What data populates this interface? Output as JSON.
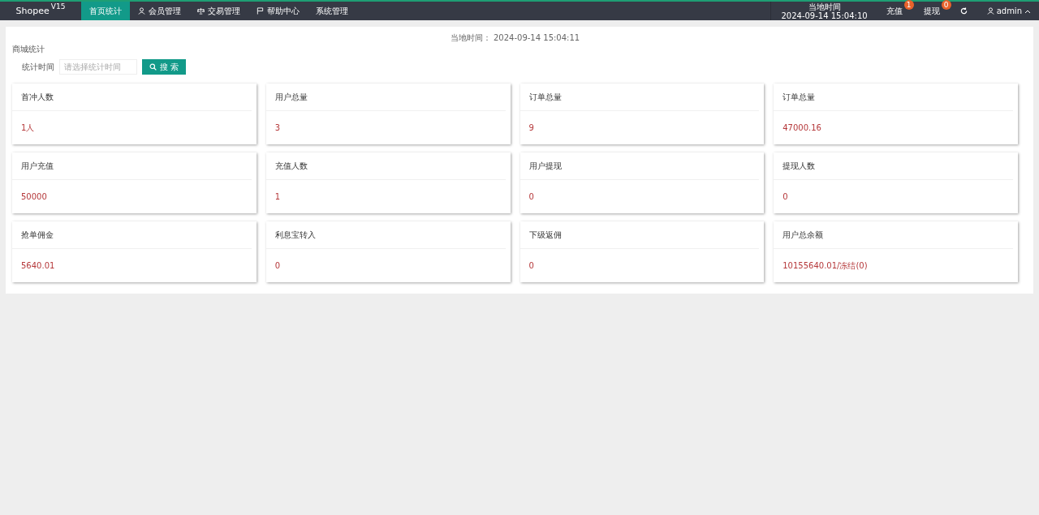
{
  "topbar": {
    "logo": "Shopee",
    "version": "V15",
    "nav": [
      {
        "label": "首页统计",
        "kind": "plain",
        "selected": true
      },
      {
        "label": "会员管理",
        "kind": "user",
        "selected": false
      },
      {
        "label": "交易管理",
        "kind": "scale",
        "selected": false
      },
      {
        "label": "帮助中心",
        "kind": "flag",
        "selected": false
      },
      {
        "label": "系统管理",
        "kind": "plain",
        "selected": false
      }
    ],
    "clock_label": "当地时间",
    "clock_value": "2024-09-14 15:04:10",
    "alerts": [
      {
        "label": "充值",
        "count": "1"
      },
      {
        "label": "提现",
        "count": "0"
      }
    ],
    "user": "admin"
  },
  "panel": {
    "title": "商城统计",
    "local_time": "当地时间： 2024-09-14 15:04:11",
    "filter": {
      "label": "统计时间",
      "placeholder": "请选择统计时间",
      "button": "搜 索"
    },
    "cards": [
      {
        "title": "首冲人数",
        "value": "1人"
      },
      {
        "title": "用户总量",
        "value": "3"
      },
      {
        "title": "订单总量",
        "value": "9"
      },
      {
        "title": "订单总量",
        "value": "47000.16"
      },
      {
        "title": "用户充值",
        "value": "50000"
      },
      {
        "title": "充值人数",
        "value": "1"
      },
      {
        "title": "用户提现",
        "value": "0"
      },
      {
        "title": "提现人数",
        "value": "0"
      },
      {
        "title": "抢单佣金",
        "value": "5640.01"
      },
      {
        "title": "利息宝转入",
        "value": "0"
      },
      {
        "title": "下级返佣",
        "value": "0"
      },
      {
        "title": "用户总余额",
        "value": "10155640.01/冻结(0)"
      }
    ]
  }
}
